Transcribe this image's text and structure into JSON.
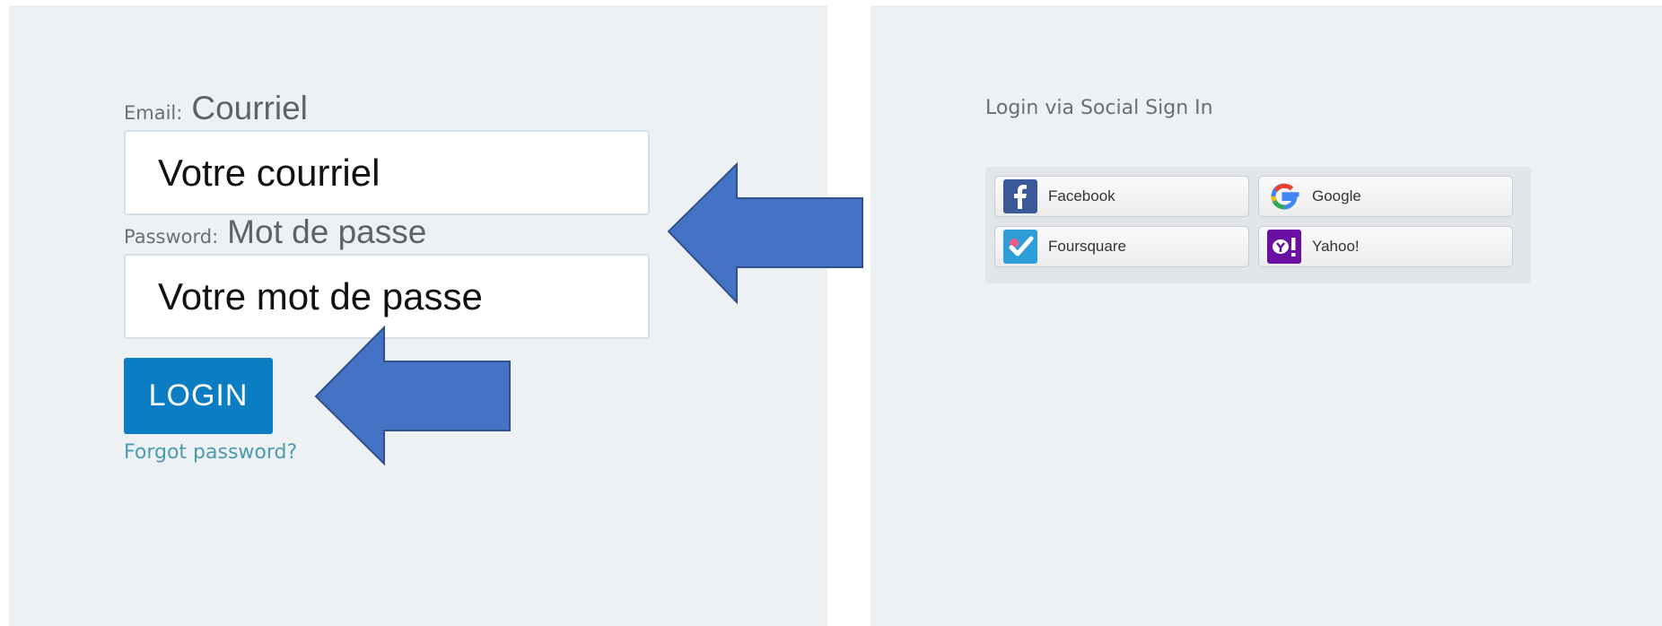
{
  "login_form": {
    "email_label": "Email:",
    "email_label_fr": "Courriel",
    "email_value": "Votre courriel",
    "password_label": "Password:",
    "password_label_fr": "Mot de passe",
    "password_value": "Votre mot de passe",
    "login_button": "LOGIN",
    "forgot_link": "Forgot password?"
  },
  "social": {
    "title": "Login via Social Sign In",
    "providers": [
      {
        "label": "Facebook",
        "icon": "facebook-icon"
      },
      {
        "label": "Google",
        "icon": "google-icon"
      },
      {
        "label": "Foursquare",
        "icon": "foursquare-icon"
      },
      {
        "label": "Yahoo!",
        "icon": "yahoo-icon"
      }
    ]
  },
  "colors": {
    "panel_bg": "#eef1f4",
    "login_button": "#0b7dc3",
    "arrow": "#4472c4",
    "link": "#4a9bb0"
  },
  "annotations": [
    "arrow-pointing-to-fields",
    "arrow-pointing-to-login"
  ]
}
